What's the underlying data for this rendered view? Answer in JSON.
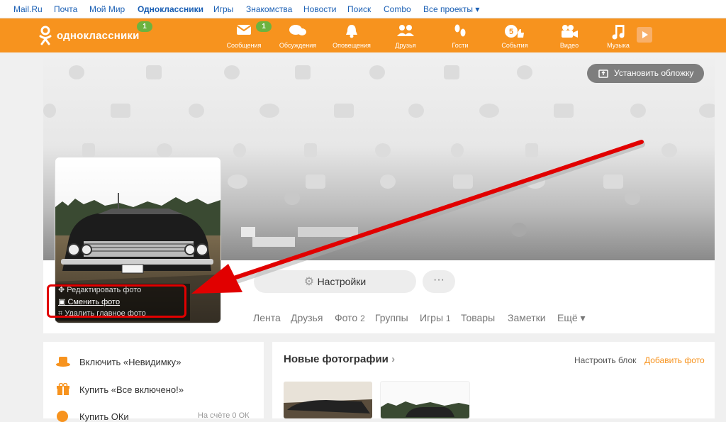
{
  "portal": {
    "links": [
      "Mail.Ru",
      "Почта",
      "Мой Мир",
      "Одноклассники",
      "Игры",
      "Знакомства",
      "Новости",
      "Поиск",
      "Combo",
      "Все проекты ▾"
    ],
    "active": "Одноклассники"
  },
  "toolbar": {
    "logo_text": "одноклассники",
    "logo_badge": "1",
    "nav": [
      {
        "label": "Сообщения",
        "icon": "envelope-icon",
        "badge": "1"
      },
      {
        "label": "Обсуждения",
        "icon": "chat-bubbles-icon",
        "badge": ""
      },
      {
        "label": "Оповещения",
        "icon": "bell-icon",
        "badge": ""
      },
      {
        "label": "Друзья",
        "icon": "friends-icon",
        "badge": ""
      },
      {
        "label": "Гости",
        "icon": "footprints-icon",
        "badge": ""
      },
      {
        "label": "События",
        "icon": "events-icon",
        "badge": "5"
      },
      {
        "label": "Видео",
        "icon": "video-camera-icon",
        "badge": ""
      },
      {
        "label": "Музыка",
        "icon": "music-note-icon",
        "badge": ""
      }
    ],
    "play_icon": "play-icon",
    "color": "#f7931e"
  },
  "cover": {
    "set_cover_label": "Установить обложку"
  },
  "avatar_menu": {
    "edit_label": "Редактировать фото",
    "change_label": "Сменить фото",
    "delete_label": "Удалить главное фото"
  },
  "profile": {
    "settings_label": "Настройки",
    "more_label": "···",
    "tabs": [
      {
        "label": "Лента"
      },
      {
        "label": "Друзья"
      },
      {
        "label": "Фото",
        "count": "2"
      },
      {
        "label": "Группы"
      },
      {
        "label": "Игры",
        "count": "1"
      },
      {
        "label": "Товары"
      },
      {
        "label": "Заметки"
      },
      {
        "label": "Ещё ▾"
      }
    ]
  },
  "left_panel": {
    "items": [
      {
        "label": "Включить «Невидимку»",
        "icon": "hat-icon"
      },
      {
        "label": "Купить «Все включено!»",
        "icon": "gift-icon"
      },
      {
        "label": "Купить ОКи",
        "icon": "ok-coin-icon",
        "extra": "На счёте 0 ОК"
      }
    ]
  },
  "photos": {
    "title": "Новые фотографии",
    "configure": "Настроить блок",
    "add_photo": "Добавить фото"
  },
  "annotation_color": "#e10000"
}
